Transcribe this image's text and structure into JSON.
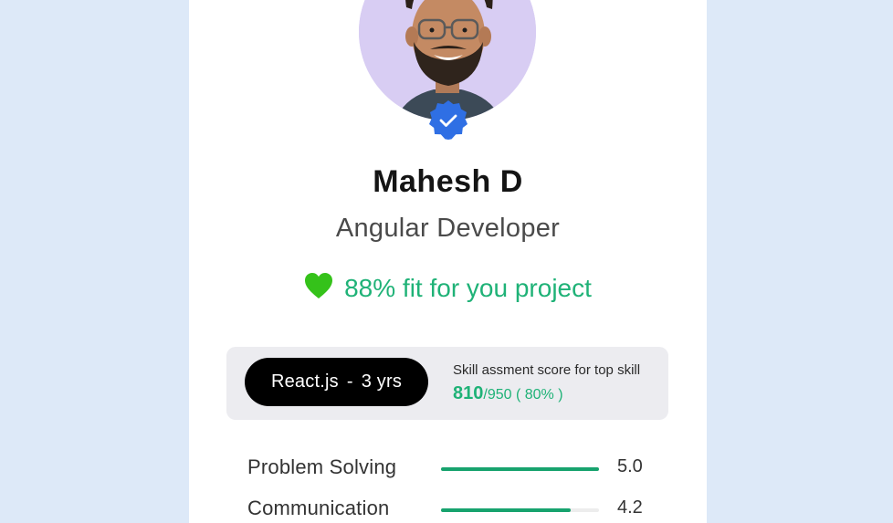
{
  "profile": {
    "name": "Mahesh D",
    "role": "Angular Developer",
    "verified": true,
    "avatar_background": "#d8cdf3"
  },
  "fit": {
    "text": "88% fit for you project",
    "icon": "heart-icon",
    "color": "#1fb277"
  },
  "top_skill": {
    "skill": "React.js",
    "separator": "-",
    "experience": "3 yrs",
    "score_caption": "Skill assment score for top skill",
    "score": "810",
    "score_rest": "/950 ( 80% )"
  },
  "metrics": [
    {
      "label": "Problem Solving",
      "value": "5.0",
      "level": 1.0
    },
    {
      "label": "Communication",
      "value": "4.2",
      "level": 0.82
    }
  ],
  "colors": {
    "page_background": "#dde9f8",
    "accent_green": "#1fb277",
    "badge_blue": "#2f6fe4",
    "heart_green": "#35c21a"
  }
}
